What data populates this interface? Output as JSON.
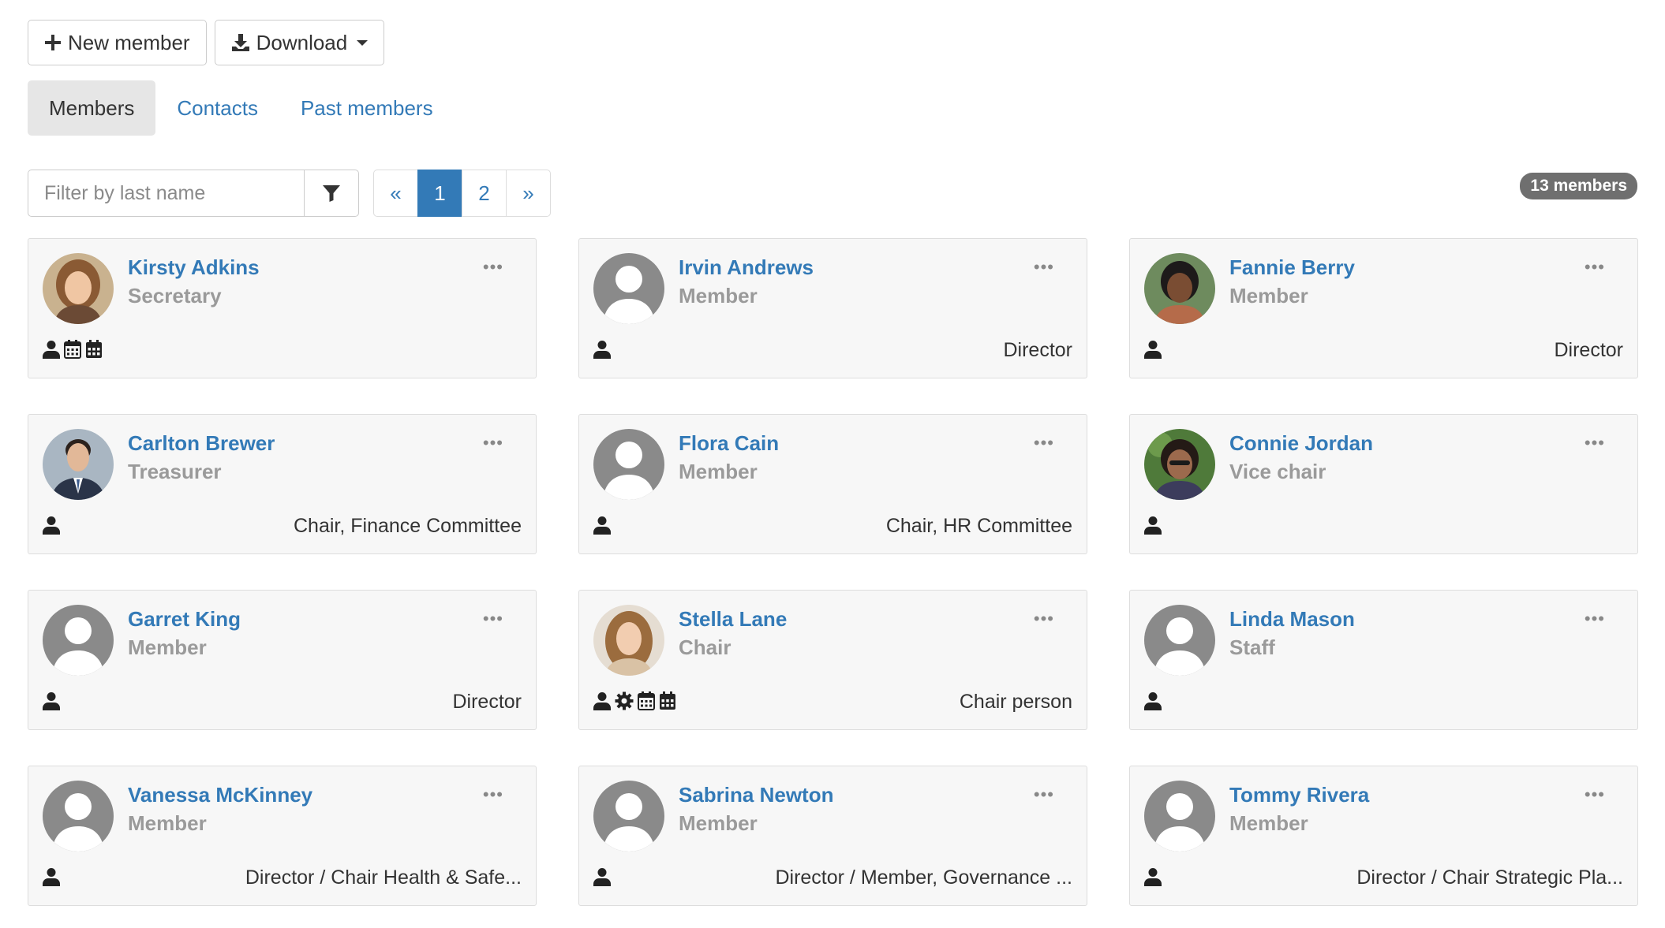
{
  "toolbar": {
    "new_member_label": "New member",
    "download_label": "Download"
  },
  "tabs": [
    {
      "label": "Members",
      "active": true
    },
    {
      "label": "Contacts",
      "active": false
    },
    {
      "label": "Past members",
      "active": false
    }
  ],
  "filter": {
    "placeholder": "Filter by last name"
  },
  "pagination": {
    "prev": "«",
    "pages": [
      "1",
      "2"
    ],
    "current": "1",
    "next": "»"
  },
  "member_count_badge": "13 members",
  "colors": {
    "link": "#337ab7",
    "role": "#9a9a9a",
    "card_bg": "#f7f7f7",
    "badge": "#6f6f6f"
  },
  "members": [
    {
      "name": "Kirsty Adkins",
      "role": "Secretary",
      "position": "",
      "photo": "photo-blonde-woman",
      "icons": [
        "user-icon",
        "calendar-icon",
        "calendar-grid-icon"
      ]
    },
    {
      "name": "Irvin Andrews",
      "role": "Member",
      "position": "Director",
      "photo": "default-avatar",
      "icons": [
        "user-icon"
      ]
    },
    {
      "name": "Fannie Berry",
      "role": "Member",
      "position": "Director",
      "photo": "photo-smiling-woman",
      "icons": [
        "user-icon"
      ]
    },
    {
      "name": "Carlton Brewer",
      "role": "Treasurer",
      "position": "Chair, Finance Committee",
      "photo": "photo-man-suit",
      "icons": [
        "user-icon"
      ]
    },
    {
      "name": "Flora Cain",
      "role": "Member",
      "position": "Chair, HR Committee",
      "photo": "default-avatar",
      "icons": [
        "user-icon"
      ]
    },
    {
      "name": "Connie Jordan",
      "role": "Vice chair",
      "position": "",
      "photo": "photo-woman-outdoors",
      "icons": [
        "user-icon"
      ]
    },
    {
      "name": "Garret King",
      "role": "Member",
      "position": "Director",
      "photo": "default-avatar",
      "icons": [
        "user-icon"
      ]
    },
    {
      "name": "Stella Lane",
      "role": "Chair",
      "position": "Chair person",
      "photo": "photo-woman-long-hair",
      "icons": [
        "user-icon",
        "gear-icon",
        "calendar-icon",
        "calendar-grid-icon"
      ]
    },
    {
      "name": "Linda Mason",
      "role": "Staff",
      "position": "",
      "photo": "default-avatar",
      "icons": [
        "user-icon"
      ]
    },
    {
      "name": "Vanessa McKinney",
      "role": "Member",
      "position": "Director / Chair Health & Safe...",
      "photo": "default-avatar",
      "icons": [
        "user-icon"
      ]
    },
    {
      "name": "Sabrina Newton",
      "role": "Member",
      "position": "Director / Member, Governance ...",
      "photo": "default-avatar",
      "icons": [
        "user-icon"
      ]
    },
    {
      "name": "Tommy Rivera",
      "role": "Member",
      "position": "Director / Chair Strategic Pla...",
      "photo": "default-avatar",
      "icons": [
        "user-icon"
      ]
    }
  ]
}
